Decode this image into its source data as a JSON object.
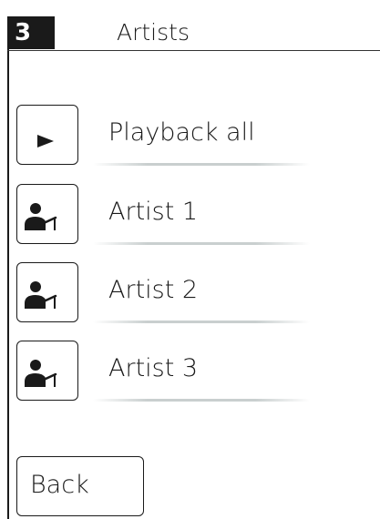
{
  "header": {
    "number": "3",
    "title": "Artists"
  },
  "list": [
    {
      "label": "Playback all",
      "icon": "play-icon"
    },
    {
      "label": "Artist 1",
      "icon": "artist-microphone-icon"
    },
    {
      "label": "Artist 2",
      "icon": "artist-microphone-icon"
    },
    {
      "label": "Artist 3",
      "icon": "artist-microphone-icon"
    }
  ],
  "footer": {
    "back_label": "Back"
  },
  "colors": {
    "foreground": "#1a1a1a",
    "background": "#ffffff",
    "underline": "#c9cfcf"
  }
}
